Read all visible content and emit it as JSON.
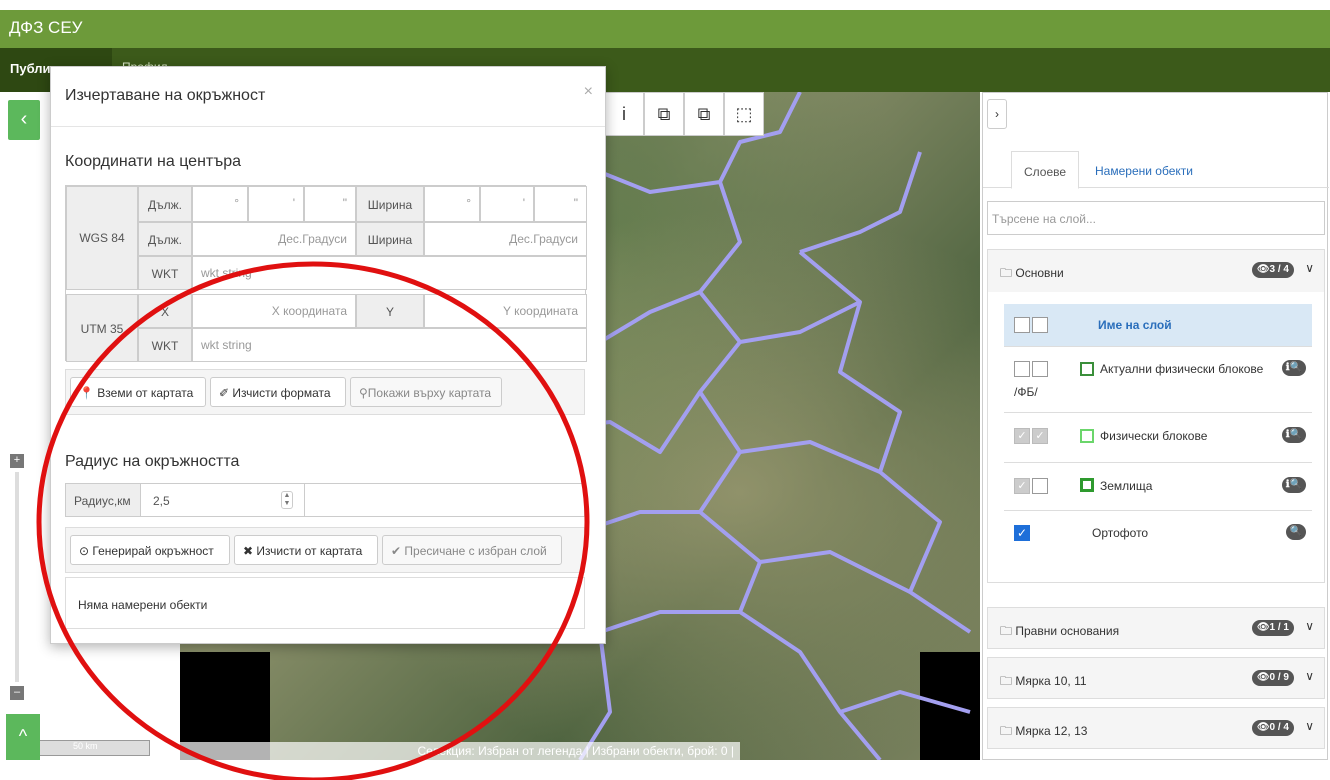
{
  "app": {
    "title": "ДФЗ СЕУ"
  },
  "nav": {
    "tab_public": "Публичен",
    "tab_second": "Профил"
  },
  "left": {
    "collapse": "‹",
    "zoom_in": "+",
    "zoom_out": "–",
    "expand": "^",
    "scale": "50 km"
  },
  "map": {
    "toolbar": [
      "i",
      "⧉",
      "⧉",
      "⬚"
    ],
    "status": "Селекция: Избран от легенда | Избрани обекти, брой: 0 |"
  },
  "modal": {
    "title": "Изчертаване на окръжност",
    "close": "×",
    "coords_title": "Координати на центъра",
    "wgs": {
      "label": "WGS 84",
      "row1_lon_label": "Дълж.",
      "row1_lat_label": "Ширина",
      "deg": "°",
      "min": "'",
      "sec": "\"",
      "row2_lon_label": "Дълж.",
      "row2_lon_placeholder": "Дес.Градуси",
      "row2_lat_label": "Ширина",
      "row2_lat_placeholder": "Дес.Градуси",
      "wkt_label": "WKT",
      "wkt_placeholder": "wkt string"
    },
    "utm": {
      "label": "UTM 35",
      "x_label": "X",
      "x_placeholder": "X координата",
      "y_label": "Y",
      "y_placeholder": "Y координата",
      "wkt_label": "WKT",
      "wkt_placeholder": "wkt string"
    },
    "btn_take": "Вземи от картата",
    "btn_clear_form": "Изчисти формата",
    "btn_show": "Покажи върху картата",
    "radius_title": "Радиус на окръжността",
    "radius_label": "Радиус,км",
    "radius_value": "2,5",
    "btn_generate": "Генерирай окръжност",
    "btn_clear_map": "Изчисти от картата",
    "btn_intersect": "Пресичане с избран слой",
    "result": "Няма намерени обекти"
  },
  "panel": {
    "toggle": "›",
    "tab_layers": "Слоеве",
    "tab_found": "Намерени обекти",
    "search_placeholder": "Търсене на слой...",
    "groups": [
      {
        "name": "Основни",
        "badge": "👁3 / 4"
      },
      {
        "name": "Правни основания",
        "badge": "👁1 / 1"
      },
      {
        "name": "Мярка 10, 11",
        "badge": "👁0 / 9"
      },
      {
        "name": "Мярка 12, 13",
        "badge": "👁0 / 4"
      }
    ],
    "layer_header": "Име на слой",
    "layers": [
      {
        "name": "Актуални физически блокове",
        "suffix": "/ФБ/",
        "swatch": "#3a8f3a",
        "info": "ℹ🔍"
      },
      {
        "name": "Физически блокове",
        "swatch": "#6bd66b",
        "info": "ℹ🔍"
      },
      {
        "name": "Землища",
        "swatch": "#2e9a2e",
        "info": "ℹ🔍"
      },
      {
        "name": "Ортофото",
        "info": "🔍"
      }
    ]
  },
  "colors": {
    "accent_green": "#6d9a3a",
    "nav_dark": "#3c5a1a",
    "button_green": "#5cb85c",
    "border_purple": "#9d98e6",
    "annotation_red": "#e01010"
  }
}
